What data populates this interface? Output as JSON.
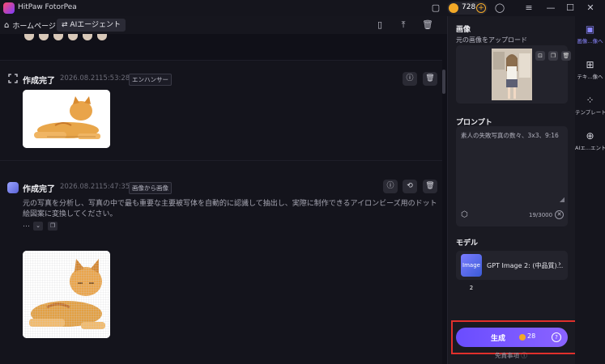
{
  "window": {
    "title": "HitPaw FotorPea",
    "credits": "728"
  },
  "nav": {
    "home_label": "ホームページ",
    "agent_tab_label": "AIエージェント"
  },
  "cards": [
    {
      "title": "作成完了",
      "date": "2026.08.21",
      "time": "15:53:28",
      "tag": "エンハンサー"
    },
    {
      "title": "作成完了",
      "date": "2026.08.21",
      "time": "15:47:35",
      "tag": "画像から画像",
      "description": "元の写真を分析し、写真の中で最も重要な主要被写体を自動的に認識して抽出し、実際に制作できるアイロンビーズ用のドット絵図案に変換してください。",
      "ellipsis": "…"
    }
  ],
  "panel": {
    "image_section": "画像",
    "upload_label": "元の画像をアップロード",
    "prompt_section": "プロンプト",
    "prompt_text": "素人の失敗写真の数々、3x3、9:16",
    "char_count": "19/3000",
    "model_section": "モデル",
    "model_name": "GPT Image 2: (中品質)...",
    "model_thumb_text": "Image 2",
    "generate_label": "生成",
    "generate_cost": "28",
    "disclaimer": "免責事項"
  },
  "sidenav": [
    {
      "label": "画像...像へ",
      "icon": "image-plus-icon",
      "active": true
    },
    {
      "label": "テキ...像へ",
      "icon": "text-image-icon",
      "active": false
    },
    {
      "label": "テンプレート",
      "icon": "template-icon",
      "active": false
    },
    {
      "label": "AIエ...エント",
      "icon": "ai-agent-icon",
      "active": false
    }
  ],
  "colors": {
    "accent": "#7b5cff",
    "highlight": "#e0302c",
    "coin": "#f3a927"
  }
}
